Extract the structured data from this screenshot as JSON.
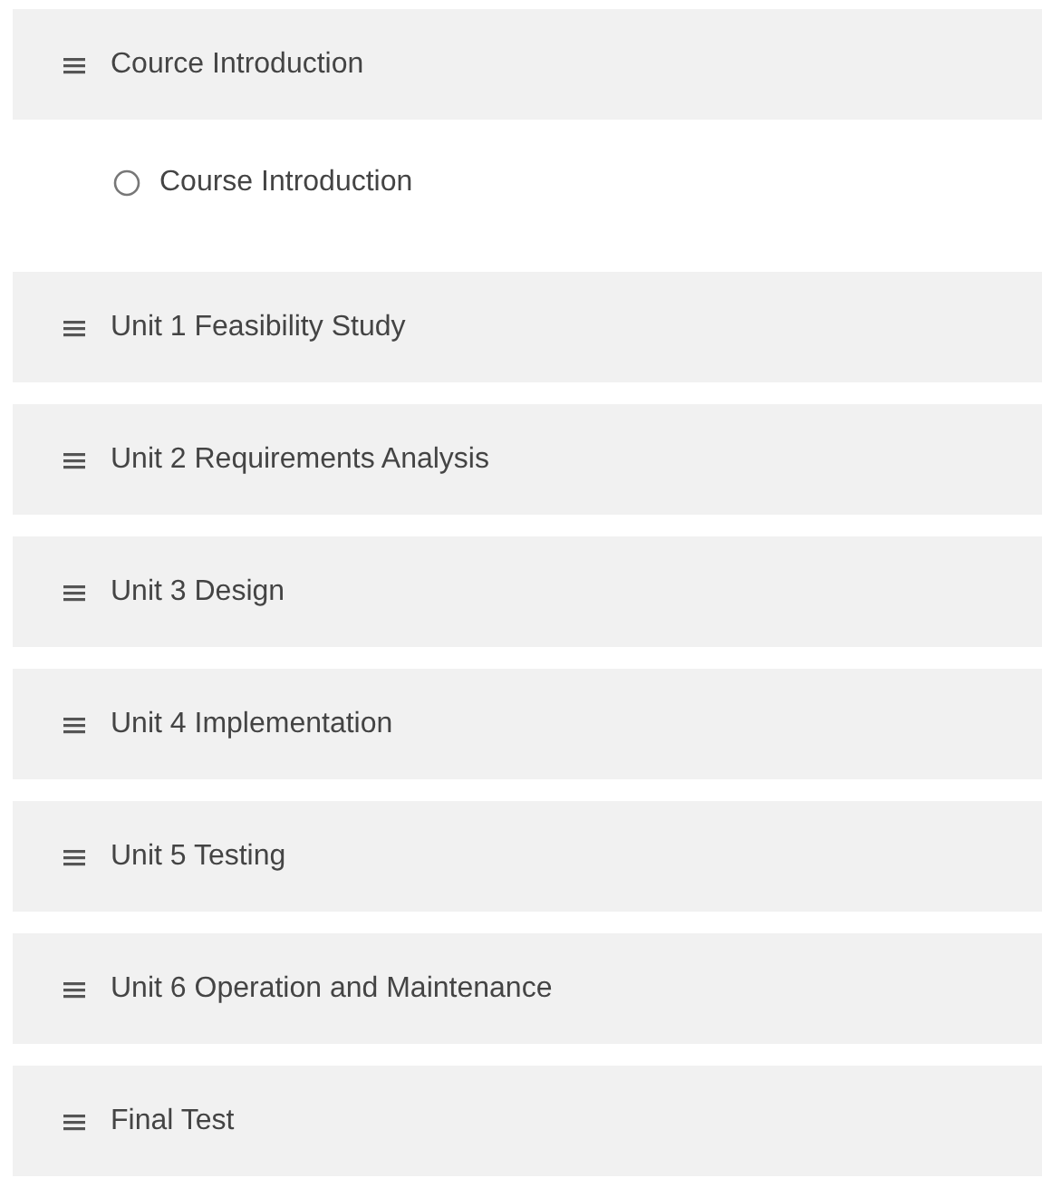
{
  "sections": [
    {
      "title": "Cource Introduction",
      "children": [
        {
          "title": "Course Introduction",
          "completed": false
        }
      ]
    },
    {
      "title": "Unit 1 Feasibility Study"
    },
    {
      "title": "Unit 2 Requirements Analysis"
    },
    {
      "title": "Unit 3 Design"
    },
    {
      "title": "Unit 4 Implementation"
    },
    {
      "title": "Unit 5 Testing"
    },
    {
      "title": "Unit 6 Operation and Maintenance"
    },
    {
      "title": "Final Test"
    }
  ]
}
